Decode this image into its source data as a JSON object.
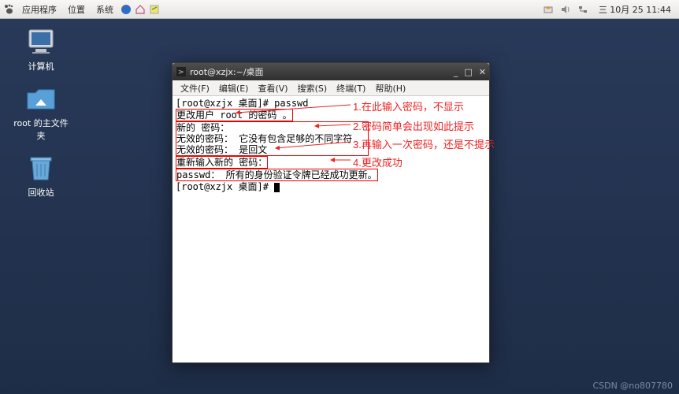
{
  "panel": {
    "apps": "应用程序",
    "places": "位置",
    "system": "系统",
    "clock": "三 10月 25 11:44"
  },
  "desktop_icons": {
    "computer": "计算机",
    "home": "root 的主文件夹",
    "trash": "回收站"
  },
  "window": {
    "title": "root@xzjx:~/桌面",
    "menu": {
      "file": "文件(F)",
      "edit": "编辑(E)",
      "view": "查看(V)",
      "search": "搜索(S)",
      "terminal": "终端(T)",
      "help": "帮助(H)"
    }
  },
  "terminal": {
    "l1": "[root@xzjx 桌面]# passwd",
    "l2": "更改用户 root 的密码 。",
    "l3": "新的 密码：",
    "l4": "无效的密码： 它没有包含足够的不同字符",
    "l5": "无效的密码： 是回文",
    "l6": "重新输入新的 密码：",
    "l7": "passwd： 所有的身份验证令牌已经成功更新。",
    "l8": "[root@xzjx 桌面]# "
  },
  "annotations": {
    "a1": "1.在此输入密码，不显示",
    "a2": "2.密码简单会出现如此提示",
    "a3": "3.再输入一次密码，还是不提示",
    "a4": "4.更改成功"
  },
  "watermark": "CSDN @no807780",
  "colors": {
    "annotation_red": "#e22222",
    "terminal_bg": "#ffffff"
  }
}
